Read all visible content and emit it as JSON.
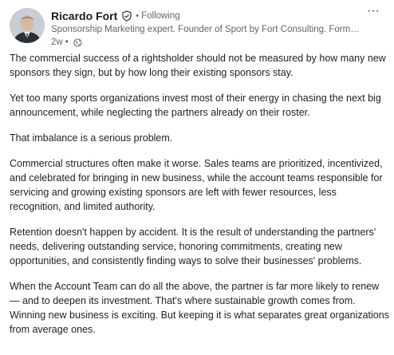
{
  "author": {
    "name": "Ricardo Fort",
    "following": "Following",
    "separator": "•",
    "headline": "Sponsorship Marketing expert. Founder of Sport by Fort Consulting. Former H...",
    "time": "2w",
    "time_separator": "•"
  },
  "icons": {
    "verified": "verified-shield-icon",
    "visibility": "globe-icon",
    "more": "more-horizontal-icon"
  },
  "more_label": "···",
  "colors": {
    "text": "#1f1f1f",
    "muted": "#666666"
  },
  "post": {
    "paragraphs": [
      "The commercial success of a rightsholder should not be measured by how many new sponsors they sign, but by how long their existing sponsors stay.",
      "Yet too many sports organizations invest most of their energy in chasing the next big announcement, while neglecting the partners already on their roster.",
      "That imbalance is a serious problem.",
      "Commercial structures often make it worse. Sales teams are prioritized, incentivized, and celebrated for bringing in new business, while the account teams responsible for servicing and growing existing sponsors are left with fewer resources, less recognition, and limited authority.",
      "Retention doesn't happen by accident. It is the result of understanding the partners' needs, delivering outstanding service, honoring commitments, creating new opportunities, and consistently finding ways to solve their businesses' problems.",
      "When the Account Team can do all the above, the partner is far more likely to renew — and to deepen its investment. That's where sustainable growth comes from. Winning new business is exciting. But keeping it is what separates great organizations from average ones."
    ]
  }
}
